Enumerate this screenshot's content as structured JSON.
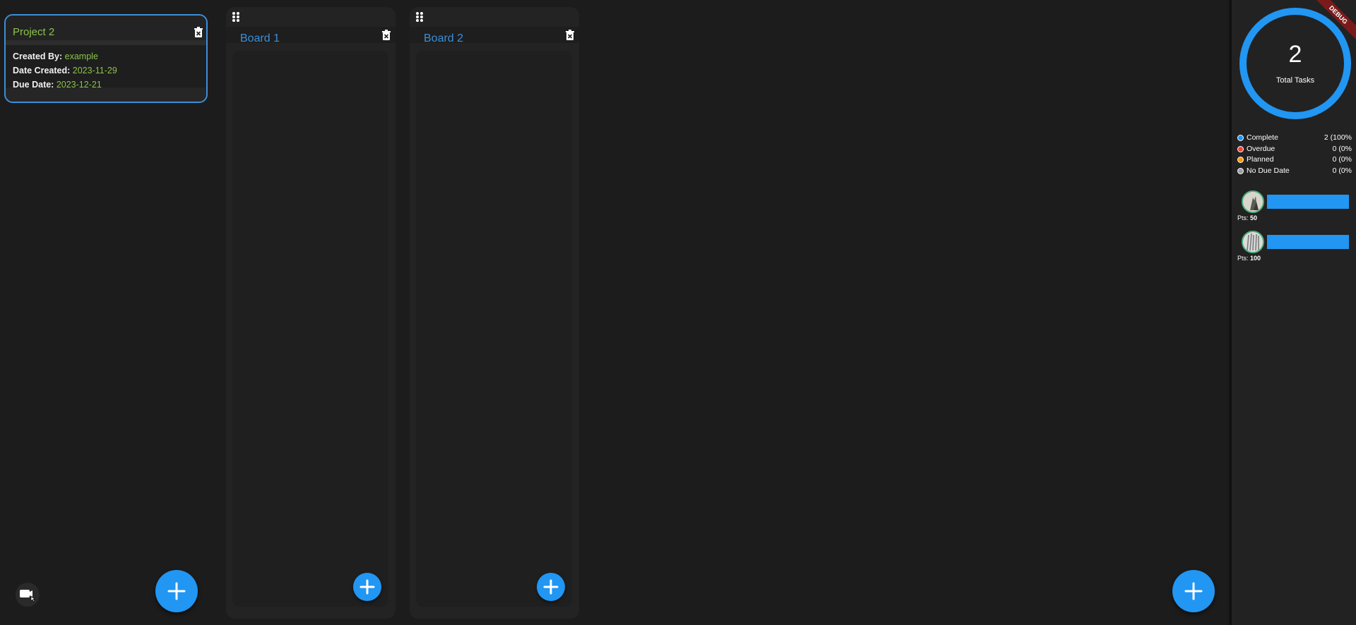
{
  "project": {
    "title": "Project 2",
    "created_by_label": "Created By:",
    "created_by": "example",
    "date_created_label": "Date Created:",
    "date_created": "2023-11-29",
    "due_date_label": "Due Date:",
    "due_date": "2023-12-21"
  },
  "boards": [
    {
      "title": "Board 1"
    },
    {
      "title": "Board 2"
    }
  ],
  "summary": {
    "total": "2",
    "total_label": "Total Tasks",
    "complete_fraction": 1.0,
    "debug_label": "DEBUG"
  },
  "legend": [
    {
      "label": "Complete",
      "value": "2 (100%",
      "color": "#2196f3"
    },
    {
      "label": "Overdue",
      "value": "0 (0%",
      "color": "#f44336"
    },
    {
      "label": "Planned",
      "value": "0 (0%",
      "color": "#ff9800"
    },
    {
      "label": "No Due Date",
      "value": "0 (0%",
      "color": "#9e9e9e"
    }
  ],
  "users": [
    {
      "pts_label": "Pts:",
      "pts": "50",
      "progress": 1.0
    },
    {
      "pts_label": "Pts:",
      "pts": "100",
      "progress": 1.0
    }
  ],
  "colors": {
    "accent": "#2196f3",
    "project_text": "#8bc34a",
    "board_title": "#3a8fd8",
    "background": "#1c1c1c"
  },
  "icons": {
    "trash": "trash-icon",
    "drag": "drag-handle-icon",
    "add": "plus-icon",
    "toggle": "toggle-view-icon"
  }
}
